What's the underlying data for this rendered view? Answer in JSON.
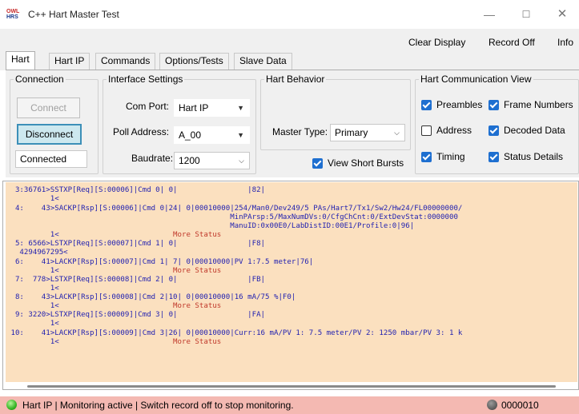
{
  "window": {
    "logo_top": "OWL",
    "logo_bottom": "HRS",
    "title": "C++ Hart Master Test",
    "min_glyph": "—",
    "max_glyph": "☐",
    "close_glyph": "✕"
  },
  "toolbar": {
    "clear_display": "Clear Display",
    "record_off": "Record Off",
    "info": "Info"
  },
  "tabs": [
    "Hart",
    "Hart IP",
    "Commands",
    "Options/Tests",
    "Slave Data"
  ],
  "connection": {
    "legend": "Connection",
    "connect_label": "Connect",
    "disconnect_label": "Disconnect",
    "status": "Connected"
  },
  "interface": {
    "legend": "Interface Settings",
    "com_port_label": "Com Port:",
    "com_port_value": "Hart IP",
    "poll_address_label": "Poll Address:",
    "poll_address_value": "A_00",
    "baudrate_label": "Baudrate:",
    "baudrate_value": "1200"
  },
  "behavior": {
    "legend": "Hart Behavior",
    "master_type_label": "Master Type:",
    "master_type_value": "Primary",
    "view_short_bursts": "View Short Bursts"
  },
  "comm_view": {
    "legend": "Hart Communication View",
    "preambles": "Preambles",
    "frame_numbers": "Frame Numbers",
    "address": "Address",
    "decoded_data": "Decoded Data",
    "timing": "Timing",
    "status_details": "Status Details"
  },
  "log": [
    {
      "t": "  3:36761>SSTXP[Req][S:00006]|Cmd 0| 0|                |82|"
    },
    {
      "t": "          1<"
    },
    {
      "t": "  4:    43>SACKP[Rsp][S:00006]|Cmd 0|24| 0|00010000|254/Man0/Dev249/5 PAs/Hart7/Tx1/Sw2/Hw24/FL00000000/"
    },
    {
      "t": "                                                   MinPArsp:5/MaxNumDVs:0/CfgChCnt:0/ExtDevStat:0000000"
    },
    {
      "t": "                                                   ManuID:0x00E0/LabDistID:00E1/Profile:0|96|"
    },
    {
      "t": "          1<",
      "r": "                          More Status"
    },
    {
      "t": "  5: 6566>LSTXP[Req][S:00007]|Cmd 1| 0|                |F8|"
    },
    {
      "t": "   4294967295<"
    },
    {
      "t": "  6:    41>LACKP[Rsp][S:00007]|Cmd 1| 7| 0|00010000|PV 1:7.5 meter|76|"
    },
    {
      "t": "          1<",
      "r": "                          More Status"
    },
    {
      "t": "  7:  778>LSTXP[Req][S:00008]|Cmd 2| 0|                |FB|"
    },
    {
      "t": "          1<"
    },
    {
      "t": "  8:    43>LACKP[Rsp][S:00008]|Cmd 2|10| 0|00010000|16 mA/75 %|F0|"
    },
    {
      "t": "          1<",
      "r": "                          More Status"
    },
    {
      "t": "  9: 3220>LSTXP[Req][S:00009]|Cmd 3| 0|                |FA|"
    },
    {
      "t": "          1<"
    },
    {
      "t": " 10:    41>LACKP[Rsp][S:00009]|Cmd 3|26| 0|00010000|Curr:16 mA/PV 1: 7.5 meter/PV 2: 1250 mbar/PV 3: 1 k"
    },
    {
      "t": "          1<",
      "r": "                          More Status"
    }
  ],
  "statusbar": {
    "text": "Hart IP  | Monitoring active | Switch record off to stop monitoring.",
    "record_count": "0000010"
  }
}
